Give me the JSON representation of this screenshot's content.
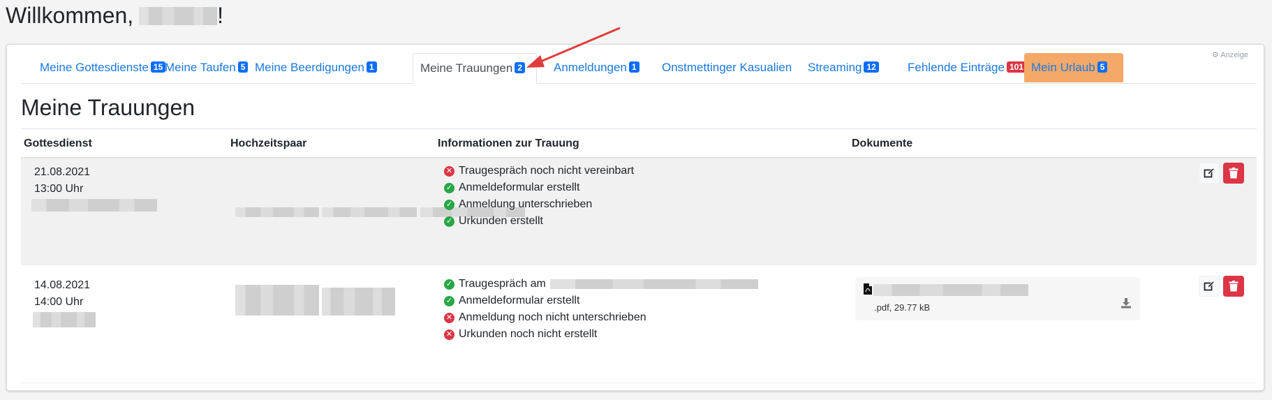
{
  "header": {
    "welcome_prefix": "Willkommen,",
    "welcome_suffix": "!"
  },
  "tabs": [
    {
      "label": "Meine Gottesdienste",
      "badge": "15",
      "badge_color": "#0d6efd"
    },
    {
      "label": "Meine Taufen",
      "badge": "5",
      "badge_color": "#0d6efd"
    },
    {
      "label": "Meine Beerdigungen",
      "badge": "1",
      "badge_color": "#0d6efd"
    },
    {
      "label": "Meine Trauungen",
      "badge": "2",
      "badge_color": "#0d6efd",
      "active": true
    },
    {
      "label": "Anmeldungen",
      "badge": "1",
      "badge_color": "#0d6efd"
    },
    {
      "label": "Onstmettinger Kasualien"
    },
    {
      "label": "Streaming",
      "badge": "12",
      "badge_color": "#0d6efd"
    },
    {
      "label": "Fehlende Einträge",
      "badge": "101",
      "badge_color": "#dc3545"
    },
    {
      "label": "Mein Urlaub",
      "badge": "5",
      "badge_color": "#0d6efd",
      "highlight_color": "#f5a968"
    }
  ],
  "settings": {
    "label": "Anzeige",
    "icon": "gear-icon"
  },
  "section": {
    "title": "Meine Trauungen"
  },
  "table": {
    "headers": [
      "Gottesdienst",
      "Hochzeitspaar",
      "Informationen zur Trauung",
      "Dokumente"
    ],
    "rows": [
      {
        "date": "21.08.2021",
        "time": "13:00 Uhr",
        "info": [
          {
            "status": "no",
            "text": "Traugespräch noch nicht vereinbart"
          },
          {
            "status": "ok",
            "text": "Anmeldeformular erstellt"
          },
          {
            "status": "ok",
            "text": "Anmeldung unterschrieben"
          },
          {
            "status": "ok",
            "text": "Urkunden erstellt"
          }
        ]
      },
      {
        "date": "14.08.2021",
        "time": "14:00 Uhr",
        "info": [
          {
            "status": "ok",
            "text": "Traugespräch am"
          },
          {
            "status": "ok",
            "text": "Anmeldeformular erstellt"
          },
          {
            "status": "no",
            "text": "Anmeldung noch nicht unterschrieben"
          },
          {
            "status": "no",
            "text": "Urkunden noch nicht erstellt"
          }
        ],
        "document": {
          "meta": ".pdf, 29.77 kB",
          "icon": "pdf-file-icon"
        }
      }
    ]
  },
  "colors": {
    "ok": "#28a745",
    "no": "#dc3545",
    "link": "#1a7ae0",
    "urlaub": "#f5a968"
  }
}
